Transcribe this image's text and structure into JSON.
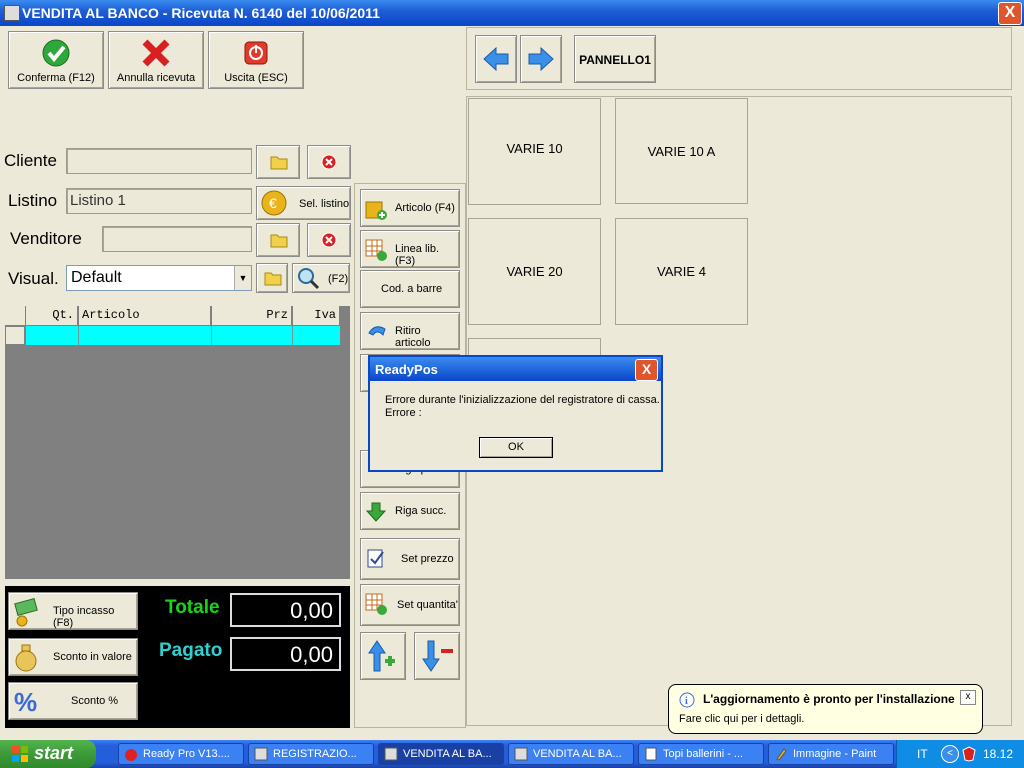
{
  "window": {
    "title": "VENDITA AL BANCO - Ricevuta N.  6140 del 10/06/2011",
    "close_label": "X"
  },
  "toolbar": {
    "confirm": "Conferma (F12)",
    "cancel": "Annulla ricevuta",
    "exit": "Uscita (ESC)"
  },
  "nav": {
    "panel_label": "PANNELLO1"
  },
  "form": {
    "cliente_label": "Cliente",
    "cliente_value": "",
    "listino_label": "Listino",
    "listino_value": "Listino 1",
    "sel_listino": "Sel. listino",
    "venditore_label": "Venditore",
    "venditore_value": "",
    "visual_label": "Visual.",
    "visual_value": "Default",
    "f2": "(F2)"
  },
  "grid": {
    "columns": [
      "Qt.",
      "Articolo",
      "Prz",
      "Iva"
    ]
  },
  "side_buttons": {
    "articolo": "Articolo (F4)",
    "linea": "Linea lib. (F3)",
    "codbarre": "Cod. a barre",
    "ritiro": "Ritiro articolo",
    "riga_prec": "Riga prec.",
    "riga_succ": "Riga succ.",
    "set_prezzo": "Set prezzo",
    "set_quantita": "Set quantita'"
  },
  "tiles": [
    "VARIE 10",
    "VARIE 10 A",
    "VARIE 20",
    "VARIE 4"
  ],
  "totals": {
    "tipo_incasso": "Tipo incasso (F8)",
    "sconto_valore": "Sconto in valore",
    "sconto_perc": "Sconto %",
    "totale_label": "Totale",
    "totale_value": "0,00",
    "pagato_label": "Pagato",
    "pagato_value": "0,00"
  },
  "dialog": {
    "title": "ReadyPos",
    "line1": "Errore durante l'inizializzazione del registratore di cassa.",
    "line2": "Errore :",
    "ok": "OK",
    "close": "X"
  },
  "balloon": {
    "title": "L'aggiornamento è pronto per l'installazione",
    "body": "Fare clic qui per i dettagli.",
    "close": "x"
  },
  "taskbar": {
    "start": "start",
    "tasks": [
      "Ready Pro V13....",
      "REGISTRAZIO...",
      "VENDITA AL BA...",
      "VENDITA AL BA...",
      "Topi ballerini - ...",
      "Immagine - Paint"
    ],
    "lang": "IT",
    "clock": "18.12"
  },
  "colors": {
    "accent": "#0a46c9",
    "total_green": "#16d61a",
    "paid_cyan": "#2fd0d0",
    "grid_row": "#00ffff"
  }
}
